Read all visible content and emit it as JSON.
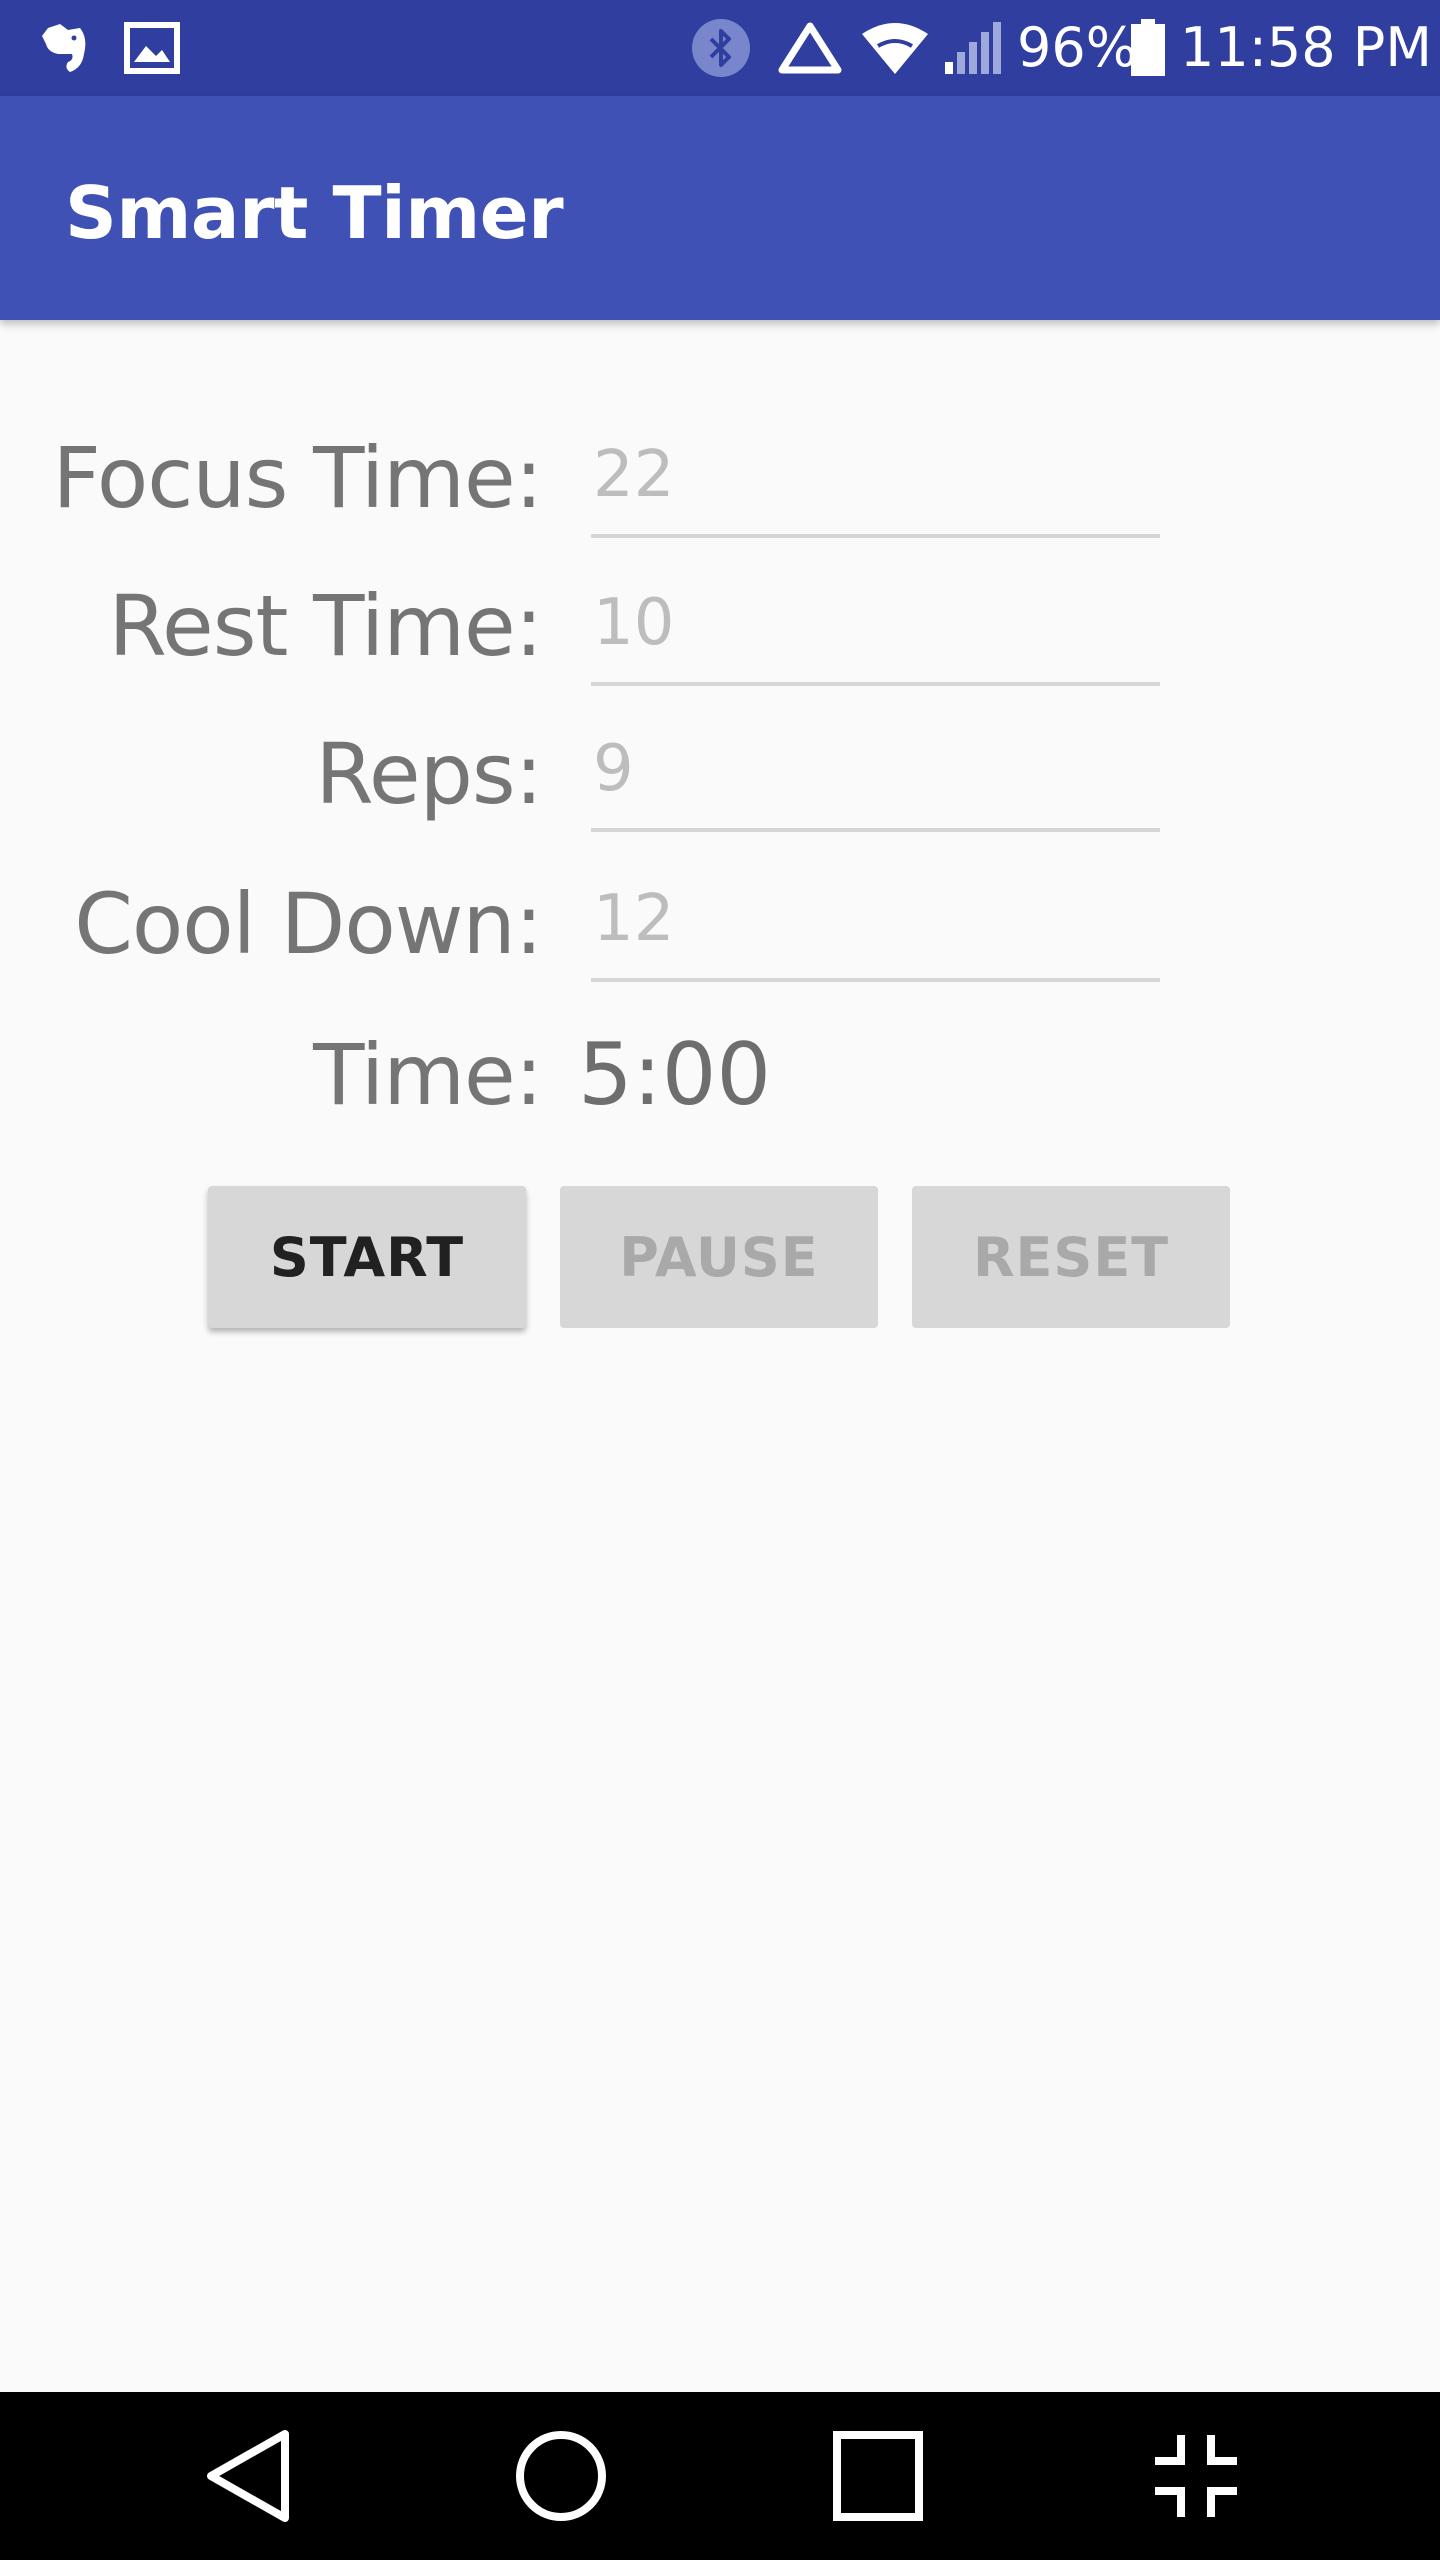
{
  "status_bar": {
    "icons_left": [
      "evernote-icon",
      "image-icon"
    ],
    "icons_right": [
      "bluetooth-icon",
      "data-saver-icon",
      "wifi-icon",
      "cell-signal-icon",
      "battery-icon"
    ],
    "battery": "96%",
    "clock": "11:58 PM"
  },
  "app_bar": {
    "title": "Smart Timer"
  },
  "form": {
    "focus_label": "Focus Time:",
    "focus_placeholder": "22",
    "rest_label": "Rest Time:",
    "rest_placeholder": "10",
    "reps_label": "Reps:",
    "reps_placeholder": "9",
    "cool_label": "Cool Down:",
    "cool_placeholder": "12",
    "time_label": "Time:",
    "time_value": "5:00"
  },
  "buttons": {
    "start": "START",
    "pause": "PAUSE",
    "reset": "RESET"
  },
  "nav_bar": {
    "icons": [
      "back-icon",
      "home-icon",
      "recents-icon",
      "exit-fullscreen-icon"
    ]
  },
  "colors": {
    "status_bar": "#303f9f",
    "app_bar": "#3f51b5",
    "background": "#fafafa",
    "button": "#d7d7d7"
  }
}
